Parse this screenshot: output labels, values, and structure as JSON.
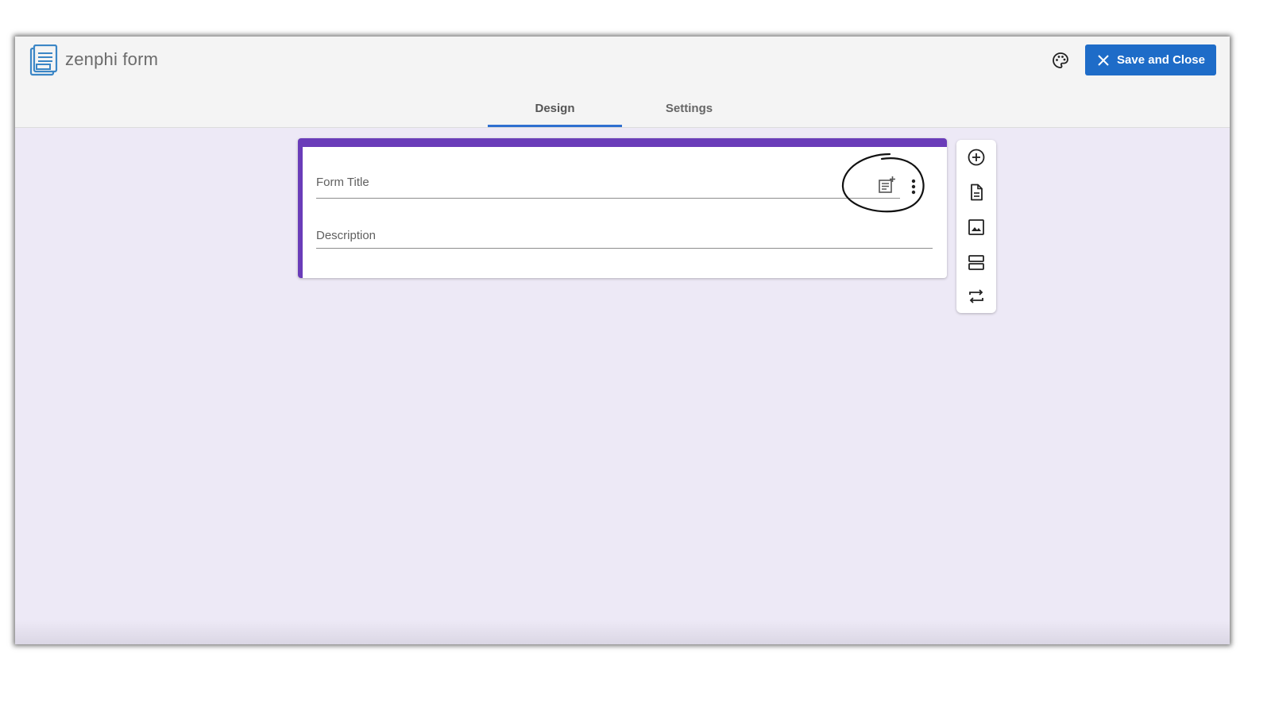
{
  "app": {
    "title": "zenphi form",
    "icons": {
      "logo": "form-document-icon",
      "palette": "palette-icon"
    }
  },
  "header": {
    "save_button": {
      "label": "Save and Close",
      "icon": "close-icon",
      "color": "#1e6cc8"
    }
  },
  "tabs": [
    {
      "label": "Design",
      "active": true
    },
    {
      "label": "Settings",
      "active": false
    }
  ],
  "form": {
    "accent_color": "#6a3cb9",
    "title_placeholder": "Form Title",
    "description_placeholder": "Description",
    "title_actions": [
      "add-note-icon",
      "more-vert-icon"
    ]
  },
  "toolbar": {
    "items": [
      "add-circle-icon",
      "document-icon",
      "image-icon",
      "section-icon",
      "swap-icon"
    ]
  },
  "colors": {
    "background": "#ede9f6",
    "header": "#f4f4f4",
    "tab_indicator": "#2f6fd0"
  }
}
